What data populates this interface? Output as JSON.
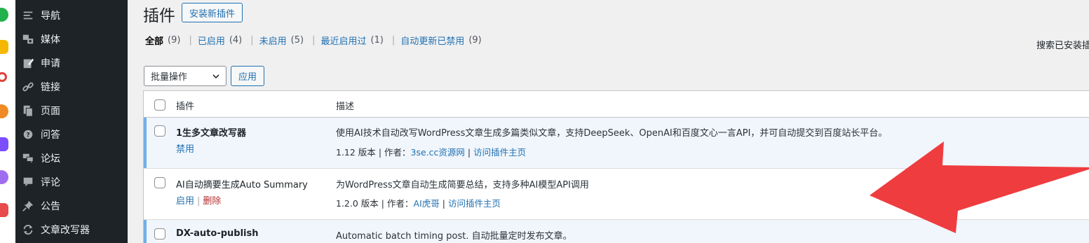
{
  "colors": {
    "sidebar_bg": "#1d2327",
    "link": "#2271b1",
    "active_row_bg": "#f0f6fc",
    "active_row_border": "#72aee6",
    "delete_link": "#b32d2e",
    "annotation_arrow": "#ef3c3f"
  },
  "sidebar": {
    "items": [
      {
        "label": "导航",
        "icon": "menu-lines-icon"
      },
      {
        "label": "媒体",
        "icon": "media-icon"
      },
      {
        "label": "申请",
        "icon": "edit-note-icon"
      },
      {
        "label": "链接",
        "icon": "link-icon"
      },
      {
        "label": "页面",
        "icon": "pages-icon"
      },
      {
        "label": "问答",
        "icon": "question-icon"
      },
      {
        "label": "论坛",
        "icon": "forum-icon"
      },
      {
        "label": "评论",
        "icon": "comment-icon"
      },
      {
        "label": "公告",
        "icon": "pin-icon"
      },
      {
        "label": "文章改写器",
        "icon": "refresh-icon"
      }
    ]
  },
  "header": {
    "title": "插件",
    "add_new": "安装新插件"
  },
  "filters": [
    {
      "label": "全部",
      "count": "(9)",
      "current": true
    },
    {
      "label": "已启用",
      "count": "(4)",
      "current": false
    },
    {
      "label": "未启用",
      "count": "(5)",
      "current": false
    },
    {
      "label": "最近启用过",
      "count": "(1)",
      "current": false
    },
    {
      "label": "自动更新已禁用",
      "count": "(9)",
      "current": false
    }
  ],
  "search": {
    "label": "搜索已安装插"
  },
  "bulk": {
    "select_value": "批量操作",
    "apply": "应用"
  },
  "table": {
    "columns": {
      "plugin": "插件",
      "description": "描述"
    },
    "rows": [
      {
        "name": "1生多文章改写器",
        "active": true,
        "actions": [
          "禁用"
        ],
        "description": "使用AI技术自动改写WordPress文章生成多篇类似文章，支持DeepSeek、OpenAI和百度文心一言API，并可自动提交到百度站长平台。",
        "version": "1.12 版本",
        "author_label": "作者：",
        "author": "3se.cc资源网",
        "visit": "访问插件主页"
      },
      {
        "name": "AI自动摘要生成Auto Summary",
        "active": false,
        "actions": [
          "启用",
          "删除"
        ],
        "description": "为WordPress文章自动生成简要总结，支持多种AI模型API调用",
        "version": "1.2.0 版本",
        "author_label": "作者：",
        "author": "AI虎哥",
        "visit": "访问插件主页"
      },
      {
        "name": "DX-auto-publish",
        "active": true,
        "actions": [],
        "description": "Automatic batch timing post. 自动批量定时发布文章。"
      }
    ]
  }
}
